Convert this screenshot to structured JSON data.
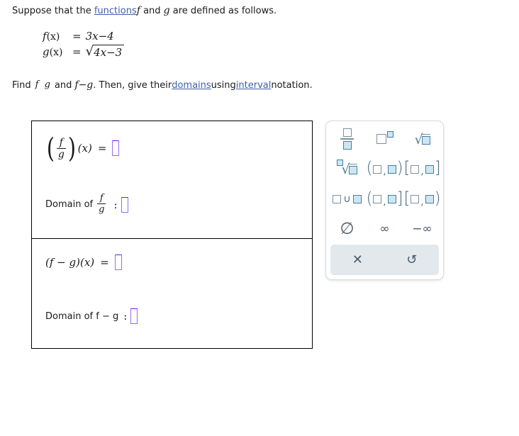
{
  "problem": {
    "intro": {
      "before_link": "Suppose that the ",
      "link": "functions",
      "after_link_f": "f",
      "and": " and ",
      "g": "g",
      "tail": " are defined as follows."
    },
    "definitions": [
      {
        "lhs_fn": "f",
        "lhs_arg": "(x)",
        "eq": "=",
        "rhs_text": "3x−4",
        "rhs_kind": "plain"
      },
      {
        "lhs_fn": "g",
        "lhs_arg": "(x)",
        "eq": "=",
        "rhs_text": "4x−3",
        "rhs_kind": "radical"
      }
    ],
    "find_line": {
      "find": "Find",
      "frac_num": "f",
      "frac_den": "g",
      "and": "and",
      "f_minus_g": "f−g",
      "then": ". Then, give their ",
      "link_domains": "domains",
      "using": " using ",
      "link_interval": "interval",
      "tail": " notation."
    }
  },
  "answers": {
    "box1": {
      "expr_open_paren": "(",
      "expr_num": "f",
      "expr_den": "g",
      "expr_close_paren": ")",
      "expr_of_x": "(x)",
      "expr_eq": "=",
      "expr_value": "",
      "domain_label": "Domain of",
      "domain_num": "f",
      "domain_den": "g",
      "domain_colon": ":",
      "domain_value": ""
    },
    "box2": {
      "expr_label": "(f − g)(x)",
      "expr_eq": "=",
      "expr_value": "",
      "domain_label": "Domain of f − g",
      "domain_colon": ":",
      "domain_value": ""
    }
  },
  "keypad": {
    "keys": [
      {
        "id": "fraction",
        "name": "fraction-key",
        "aria": "□/□"
      },
      {
        "id": "exponent",
        "name": "exponent-key",
        "aria": "□^□"
      },
      {
        "id": "square-root",
        "name": "square-root-key",
        "aria": "√□"
      },
      {
        "id": "nth-root",
        "name": "nth-root-key",
        "aria": "ⁿ√□"
      },
      {
        "id": "open-interval",
        "name": "open-interval-key",
        "aria": "(□,□)"
      },
      {
        "id": "closed-interval",
        "name": "closed-interval-key",
        "aria": "[□,□]"
      },
      {
        "id": "union",
        "name": "union-key",
        "aria": "□∪□"
      },
      {
        "id": "half-open-right",
        "name": "half-open-right-key",
        "aria": "(□,□]"
      },
      {
        "id": "half-open-left",
        "name": "half-open-left-key",
        "aria": "[□,□)"
      },
      {
        "id": "empty-set",
        "name": "empty-set-key",
        "aria": "∅",
        "glyph": "∅"
      },
      {
        "id": "infinity",
        "name": "infinity-key",
        "aria": "∞",
        "glyph": "∞"
      },
      {
        "id": "neg-infinity",
        "name": "negative-infinity-key",
        "aria": "-∞",
        "glyph": "−∞"
      }
    ],
    "footer": {
      "clear_glyph": "✕",
      "clear_name": "clear-button",
      "undo_glyph": "↺",
      "undo_name": "undo-button"
    }
  },
  "colors": {
    "link": "#3f5fa8",
    "input_border": "#9b6bf2",
    "keypad_blue": "#3f7fa6",
    "keypad_fill": "#cfe6f2",
    "keypad_gray": "#7e8f9e",
    "footer_bg": "#e2e8ec",
    "symbol": "#4a5b6b"
  }
}
